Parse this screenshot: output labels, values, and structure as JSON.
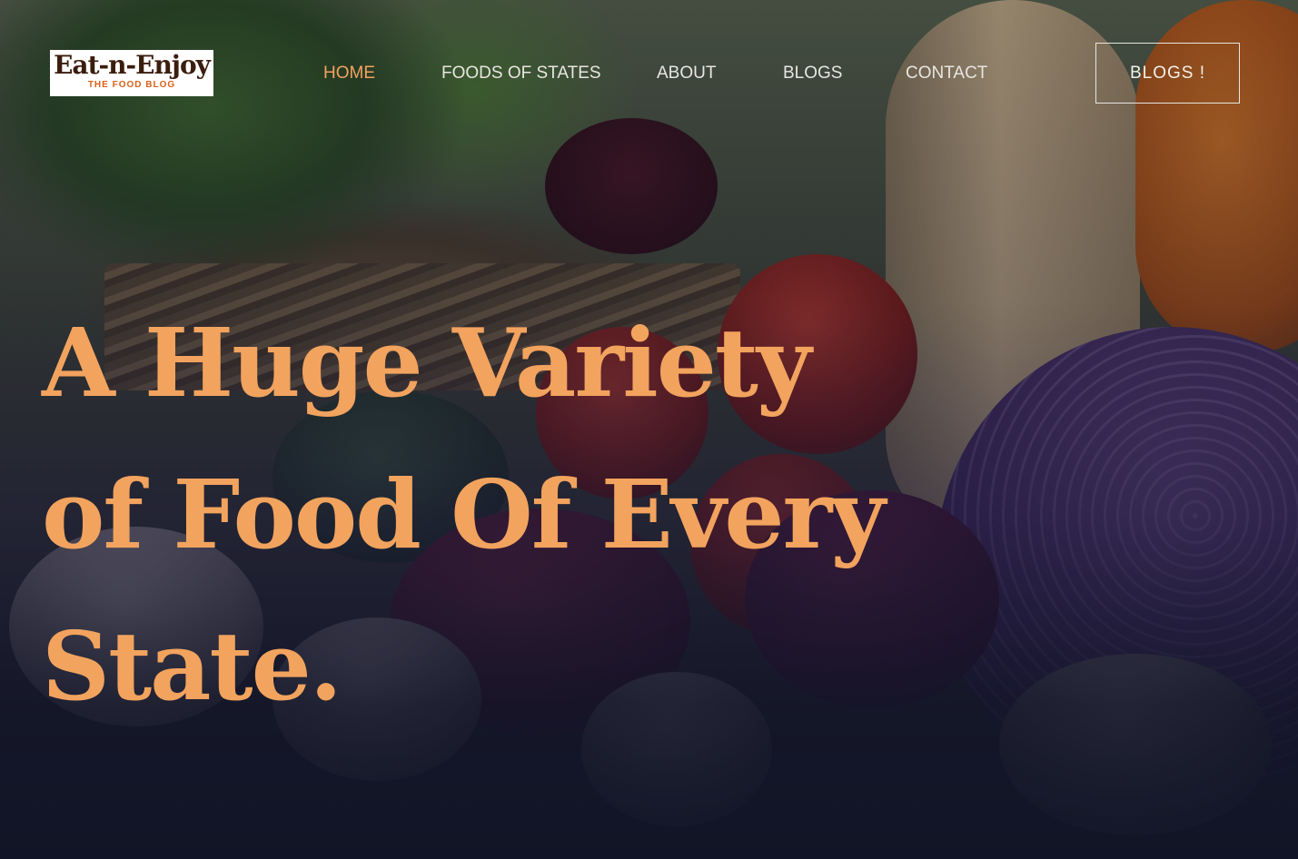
{
  "logo": {
    "title": "Eat-n-Enjoy",
    "subtitle": "THE FOOD BLOG"
  },
  "nav": {
    "items": [
      {
        "label": "HOME",
        "active": true
      },
      {
        "label": "FOODS OF STATES",
        "active": false
      },
      {
        "label": "ABOUT",
        "active": false
      },
      {
        "label": "BLOGS",
        "active": false
      },
      {
        "label": "CONTACT",
        "active": false
      }
    ],
    "cta_label": "BLOGS !"
  },
  "hero": {
    "headline_lines": [
      "A Huge Variety",
      "of Food Of Every",
      "State."
    ]
  },
  "colors": {
    "accent": "#f2a35e",
    "nav_text": "#e8e6e0",
    "background_dark": "#12152a",
    "logo_text": "#3b1d0e",
    "logo_subtitle": "#d9601a"
  }
}
